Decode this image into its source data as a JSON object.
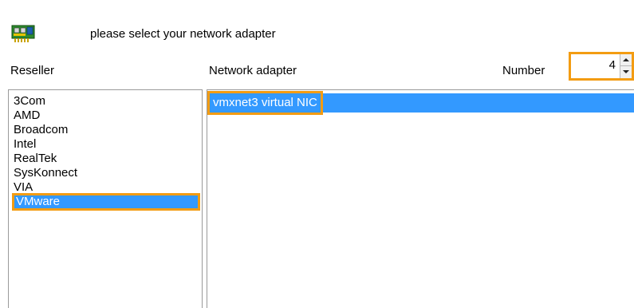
{
  "header": {
    "icon": "network-card-icon",
    "prompt": "please select your network adapter"
  },
  "labels": {
    "reseller": "Reseller",
    "network_adapter": "Network adapter",
    "number": "Number"
  },
  "number_spinner": {
    "value": "4"
  },
  "reseller_list": {
    "items": [
      "3Com",
      "AMD",
      "Broadcom",
      "Intel",
      "RealTek",
      "SysKonnect",
      "VIA",
      "VMware"
    ],
    "selected": "VMware"
  },
  "adapter_list": {
    "items": [
      "vmxnet3 virtual NIC"
    ],
    "selected": "vmxnet3 virtual NIC"
  },
  "colors": {
    "selection": "#3399ff",
    "highlight_outline": "#f39c12"
  }
}
